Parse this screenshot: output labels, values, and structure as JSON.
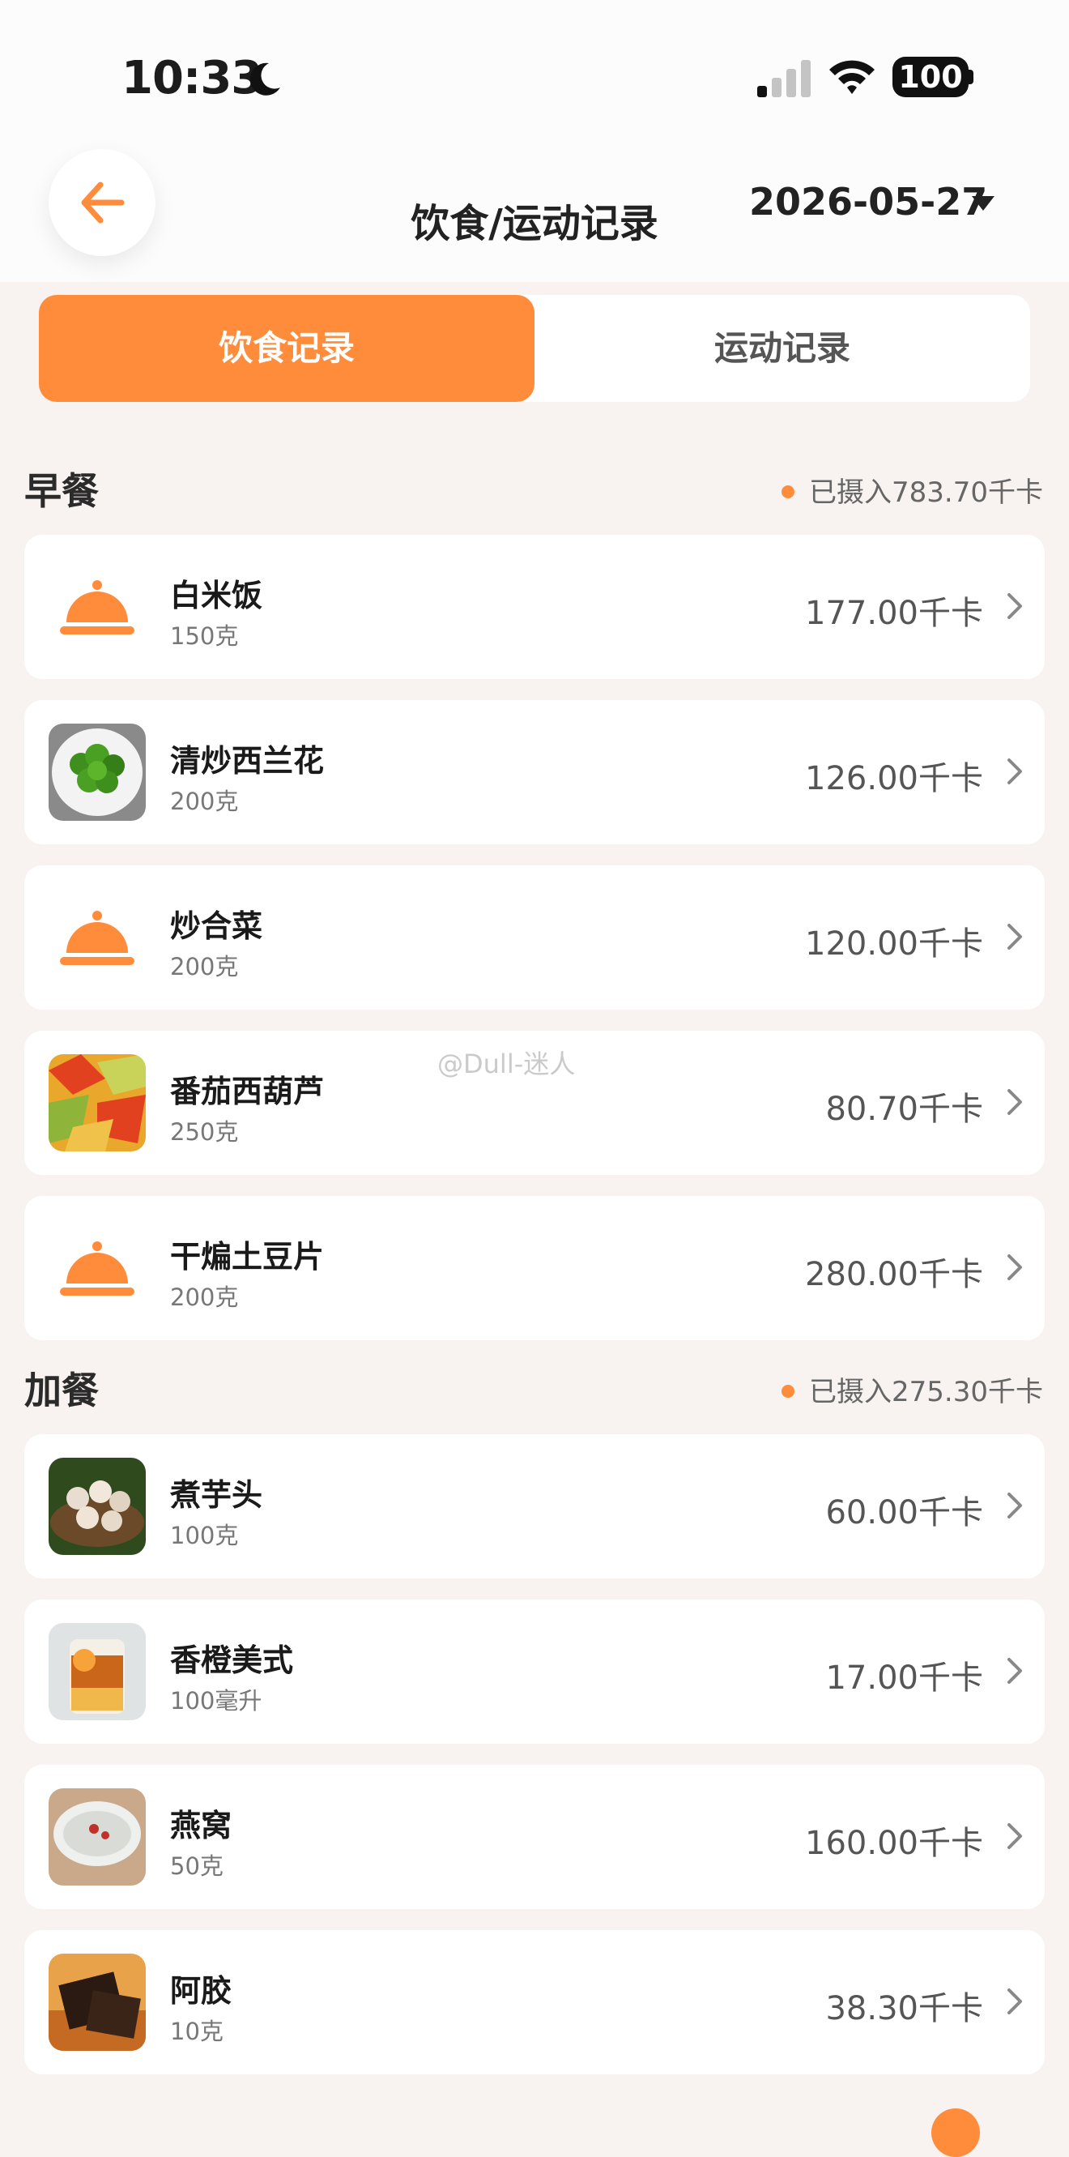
{
  "status_bar": {
    "time": "10:33",
    "battery": "100"
  },
  "header": {
    "title": "饮食/运动记录",
    "date": "2026-05-27"
  },
  "tabs": [
    {
      "label": "饮食记录"
    },
    {
      "label": "运动记录"
    }
  ],
  "sections": [
    {
      "title": "早餐",
      "summary": "已摄入783.70千卡",
      "items": [
        {
          "name": "白米饭",
          "amount": "150克",
          "kcal": "177.00千卡",
          "icon": "cloche-icon"
        },
        {
          "name": "清炒西兰花",
          "amount": "200克",
          "kcal": "126.00千卡",
          "icon": "broccoli-photo"
        },
        {
          "name": "炒合菜",
          "amount": "200克",
          "kcal": "120.00千卡",
          "icon": "cloche-icon"
        },
        {
          "name": "番茄西葫芦",
          "amount": "250克",
          "kcal": "80.70千卡",
          "icon": "tomato-zucchini-photo"
        },
        {
          "name": "干煸土豆片",
          "amount": "200克",
          "kcal": "280.00千卡",
          "icon": "cloche-icon"
        }
      ]
    },
    {
      "title": "加餐",
      "summary": "已摄入275.30千卡",
      "items": [
        {
          "name": "煮芋头",
          "amount": "100克",
          "kcal": "60.00千卡",
          "icon": "taro-photo"
        },
        {
          "name": "香橙美式",
          "amount": "100毫升",
          "kcal": "17.00千卡",
          "icon": "orange-americano-photo"
        },
        {
          "name": "燕窝",
          "amount": "50克",
          "kcal": "160.00千卡",
          "icon": "birds-nest-photo"
        },
        {
          "name": "阿胶",
          "amount": "10克",
          "kcal": "38.30千卡",
          "icon": "ejiao-photo"
        }
      ]
    }
  ],
  "watermark": "@Dull-迷人",
  "colors": {
    "accent": "#ff8c3b",
    "background": "#f8f3f0"
  }
}
